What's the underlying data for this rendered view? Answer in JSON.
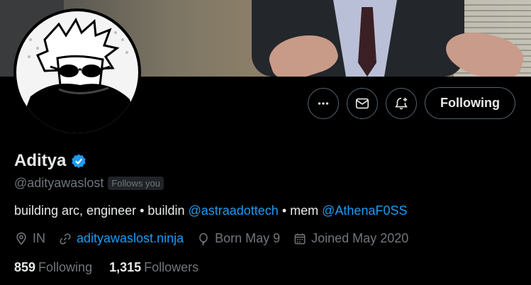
{
  "colors": {
    "background": "#000000",
    "text_primary": "#e7e9ea",
    "text_secondary": "#71767b",
    "link": "#1d9bf0",
    "border": "#536471"
  },
  "actions": {
    "more_icon": "more-horizontal-icon",
    "message_icon": "envelope-icon",
    "notify_icon": "bell-plus-icon",
    "follow_label": "Following"
  },
  "profile": {
    "display_name": "Aditya",
    "handle": "@adityawaslost",
    "follows_you": "Follows you",
    "bio": {
      "text1": "building arc, engineer • buildin ",
      "mention1": "@astraadottech",
      "text2": " • mem ",
      "mention2": "@AthenaF0SS"
    },
    "meta": {
      "location": "IN",
      "website": "adityawaslost.ninja",
      "birthday": "Born May 9",
      "joined": "Joined May 2020"
    },
    "stats": {
      "following_count": "859",
      "following_label": "Following",
      "followers_count": "1,315",
      "followers_label": "Followers"
    }
  }
}
